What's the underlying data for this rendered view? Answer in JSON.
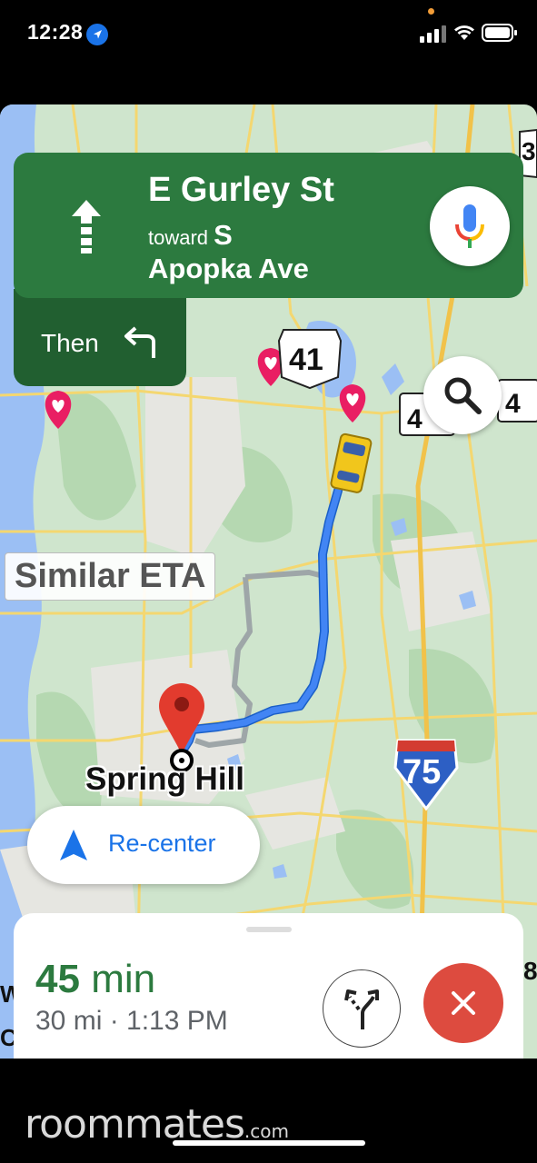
{
  "status_bar": {
    "time": "12:28"
  },
  "navigation": {
    "street_name": "E Gurley St",
    "toward_prefix": "toward",
    "toward_name_part1": "S",
    "toward_name_part2": "Apopka Ave",
    "then_label": "Then"
  },
  "map": {
    "eta_comparison": "Similar ETA",
    "city_label": "Spring Hill",
    "highway_41": "41",
    "interstate_75": "75",
    "partial_shield_1": "4",
    "partial_shield_2": "4",
    "edge_label_top": "3",
    "edge_label_right": "8",
    "edge_label_left_1": "W",
    "edge_label_left_2": "C"
  },
  "recenter": {
    "label": "Re-center"
  },
  "trip": {
    "duration_value": "45",
    "duration_unit": "min",
    "summary": "30 mi · 1:13 PM"
  },
  "watermark": {
    "brand": "roommates",
    "tld": ".com"
  },
  "colors": {
    "nav_green": "#2c7a3f",
    "nav_green_dark": "#215f30",
    "route_blue": "#4285f4",
    "exit_red": "#dd4b3f",
    "recenter_blue": "#1a73e8"
  },
  "icons": {
    "location_arrow": "location-arrow-icon",
    "straight": "straight-arrow-icon",
    "turn_left": "turn-left-icon",
    "mic": "microphone-icon",
    "search": "search-icon",
    "recenter": "navigation-arrow-icon",
    "routes": "alternate-routes-icon",
    "exit": "close-icon"
  }
}
